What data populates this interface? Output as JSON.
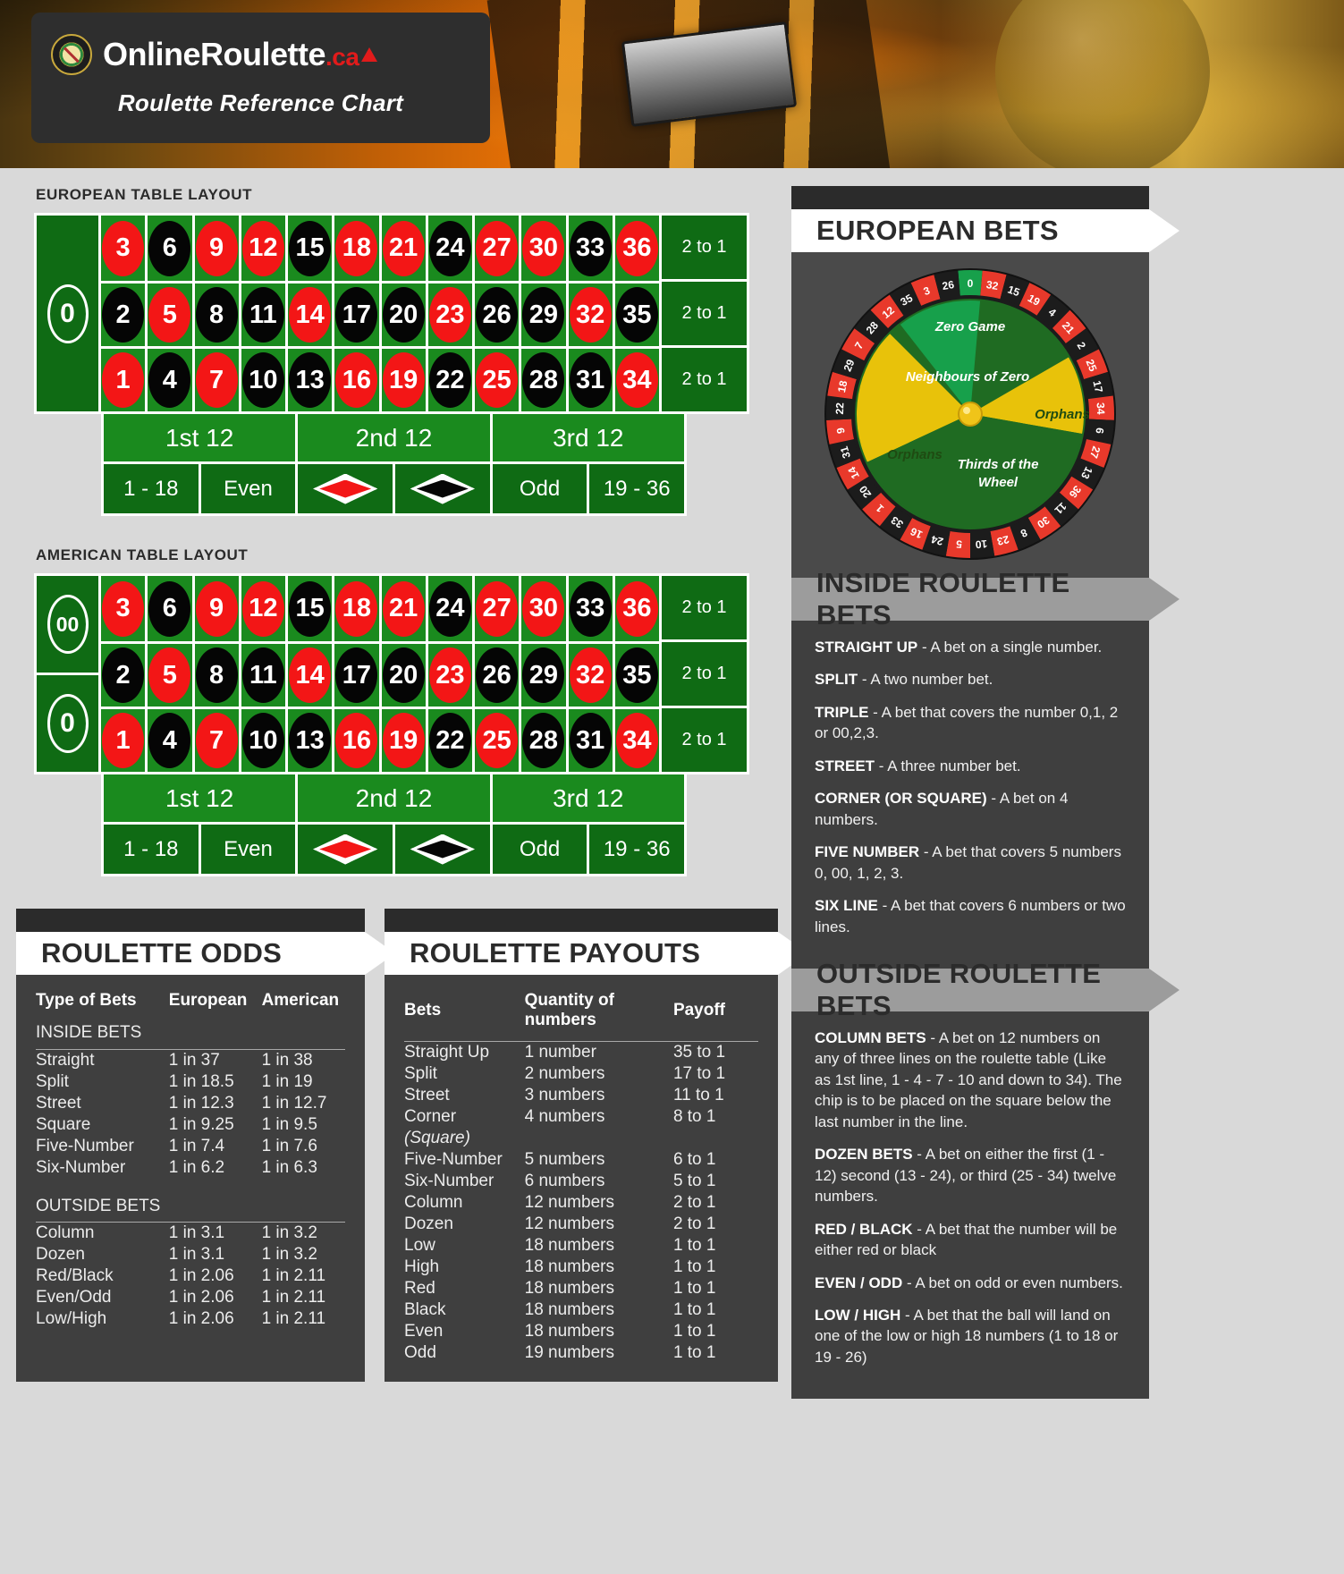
{
  "header": {
    "brand_online": "Online",
    "brand_roulette": "Roulette",
    "brand_tld": ".ca",
    "subtitle": "Roulette Reference Chart",
    "logo_icon": "roulette-wheel-chip-icon",
    "maple_icon": "maple-leaf-icon"
  },
  "european_table": {
    "label": "EUROPEAN TABLE LAYOUT",
    "zero": "0",
    "rows": [
      [
        {
          "n": "3",
          "c": "red"
        },
        {
          "n": "6",
          "c": "black"
        },
        {
          "n": "9",
          "c": "red"
        },
        {
          "n": "12",
          "c": "red"
        },
        {
          "n": "15",
          "c": "black"
        },
        {
          "n": "18",
          "c": "red"
        },
        {
          "n": "21",
          "c": "red"
        },
        {
          "n": "24",
          "c": "black"
        },
        {
          "n": "27",
          "c": "red"
        },
        {
          "n": "30",
          "c": "red"
        },
        {
          "n": "33",
          "c": "black"
        },
        {
          "n": "36",
          "c": "red"
        }
      ],
      [
        {
          "n": "2",
          "c": "black"
        },
        {
          "n": "5",
          "c": "red"
        },
        {
          "n": "8",
          "c": "black"
        },
        {
          "n": "11",
          "c": "black"
        },
        {
          "n": "14",
          "c": "red"
        },
        {
          "n": "17",
          "c": "black"
        },
        {
          "n": "20",
          "c": "black"
        },
        {
          "n": "23",
          "c": "red"
        },
        {
          "n": "26",
          "c": "black"
        },
        {
          "n": "29",
          "c": "black"
        },
        {
          "n": "32",
          "c": "red"
        },
        {
          "n": "35",
          "c": "black"
        }
      ],
      [
        {
          "n": "1",
          "c": "red"
        },
        {
          "n": "4",
          "c": "black"
        },
        {
          "n": "7",
          "c": "red"
        },
        {
          "n": "10",
          "c": "black"
        },
        {
          "n": "13",
          "c": "black"
        },
        {
          "n": "16",
          "c": "red"
        },
        {
          "n": "19",
          "c": "red"
        },
        {
          "n": "22",
          "c": "black"
        },
        {
          "n": "25",
          "c": "red"
        },
        {
          "n": "28",
          "c": "black"
        },
        {
          "n": "31",
          "c": "black"
        },
        {
          "n": "34",
          "c": "red"
        }
      ]
    ],
    "column_bets": [
      "2 to 1",
      "2 to 1",
      "2 to 1"
    ],
    "dozens": [
      "1st 12",
      "2nd 12",
      "3rd 12"
    ],
    "outside": [
      "1 - 18",
      "Even",
      "red-diamond",
      "black-diamond",
      "Odd",
      "19 - 36"
    ]
  },
  "american_table": {
    "label": "AMERICAN TABLE LAYOUT",
    "zero_double": "00",
    "zero_single": "0",
    "rows": [
      [
        {
          "n": "3",
          "c": "red"
        },
        {
          "n": "6",
          "c": "black"
        },
        {
          "n": "9",
          "c": "red"
        },
        {
          "n": "12",
          "c": "red"
        },
        {
          "n": "15",
          "c": "black"
        },
        {
          "n": "18",
          "c": "red"
        },
        {
          "n": "21",
          "c": "red"
        },
        {
          "n": "24",
          "c": "black"
        },
        {
          "n": "27",
          "c": "red"
        },
        {
          "n": "30",
          "c": "red"
        },
        {
          "n": "33",
          "c": "black"
        },
        {
          "n": "36",
          "c": "red"
        }
      ],
      [
        {
          "n": "2",
          "c": "black"
        },
        {
          "n": "5",
          "c": "red"
        },
        {
          "n": "8",
          "c": "black"
        },
        {
          "n": "11",
          "c": "black"
        },
        {
          "n": "14",
          "c": "red"
        },
        {
          "n": "17",
          "c": "black"
        },
        {
          "n": "20",
          "c": "black"
        },
        {
          "n": "23",
          "c": "red"
        },
        {
          "n": "26",
          "c": "black"
        },
        {
          "n": "29",
          "c": "black"
        },
        {
          "n": "32",
          "c": "red"
        },
        {
          "n": "35",
          "c": "black"
        }
      ],
      [
        {
          "n": "1",
          "c": "red"
        },
        {
          "n": "4",
          "c": "black"
        },
        {
          "n": "7",
          "c": "red"
        },
        {
          "n": "10",
          "c": "black"
        },
        {
          "n": "13",
          "c": "black"
        },
        {
          "n": "16",
          "c": "red"
        },
        {
          "n": "19",
          "c": "red"
        },
        {
          "n": "22",
          "c": "black"
        },
        {
          "n": "25",
          "c": "red"
        },
        {
          "n": "28",
          "c": "black"
        },
        {
          "n": "31",
          "c": "black"
        },
        {
          "n": "34",
          "c": "red"
        }
      ]
    ],
    "column_bets": [
      "2 to 1",
      "2 to 1",
      "2 to 1"
    ],
    "dozens": [
      "1st 12",
      "2nd 12",
      "3rd 12"
    ],
    "outside": [
      "1 - 18",
      "Even",
      "red-diamond",
      "black-diamond",
      "Odd",
      "19 - 36"
    ]
  },
  "european_bets": {
    "title": "EUROPEAN BETS",
    "wheel_order": [
      "0",
      "32",
      "15",
      "19",
      "4",
      "21",
      "2",
      "25",
      "17",
      "34",
      "6",
      "27",
      "13",
      "36",
      "11",
      "30",
      "8",
      "23",
      "10",
      "5",
      "24",
      "16",
      "33",
      "1",
      "20",
      "14",
      "31",
      "9",
      "22",
      "18",
      "29",
      "7",
      "28",
      "12",
      "35",
      "3",
      "26"
    ],
    "wheel_red": [
      "32",
      "19",
      "21",
      "25",
      "34",
      "27",
      "36",
      "30",
      "23",
      "5",
      "16",
      "1",
      "14",
      "9",
      "18",
      "7",
      "12",
      "3"
    ],
    "sector_labels": [
      "Zero Game",
      "Neighbours of Zero",
      "Orphans",
      "Orphans",
      "Thirds of the Wheel"
    ]
  },
  "inside_bets": {
    "title": "INSIDE ROULETTE BETS",
    "items": [
      {
        "term": "STRAIGHT UP",
        "desc": " - A bet on a single number."
      },
      {
        "term": "SPLIT",
        "desc": " - A two number bet."
      },
      {
        "term": "TRIPLE",
        "desc": " - A bet that covers the number 0,1, 2 or 00,2,3."
      },
      {
        "term": "STREET",
        "desc": " - A three number bet."
      },
      {
        "term": "CORNER (OR SQUARE)",
        "desc": " - A bet on 4 numbers."
      },
      {
        "term": "FIVE NUMBER",
        "desc": " - A bet that covers 5 numbers 0, 00, 1, 2, 3."
      },
      {
        "term": "SIX LINE",
        "desc": " - A bet that covers 6 numbers or two lines."
      }
    ]
  },
  "outside_bets": {
    "title": "OUTSIDE ROULETTE BETS",
    "items": [
      {
        "term": "COLUMN BETS",
        "desc": " - A bet on 12 numbers on any of three lines on the roulette table (Like as 1st line, 1 - 4 - 7 - 10 and down to 34). The chip is to be placed on the square below the last number in the line."
      },
      {
        "term": "DOZEN BETS",
        "desc": " - A bet on either the first (1 - 12) second (13 - 24), or third (25 - 34) twelve numbers."
      },
      {
        "term": "RED / BLACK",
        "desc": " - A bet that the number will be either red or black"
      },
      {
        "term": "EVEN / ODD",
        "desc": " - A bet on odd or even numbers."
      },
      {
        "term": "LOW / HIGH",
        "desc": " - A bet that the ball will land on one of the low or high 18 numbers (1 to 18 or 19 - 26)"
      }
    ]
  },
  "odds": {
    "title": "ROULETTE ODDS",
    "headers": [
      "Type of Bets",
      "European",
      "American"
    ],
    "group1": "INSIDE BETS",
    "rows1": [
      [
        "Straight",
        "1 in 37",
        "1 in 38"
      ],
      [
        "Split",
        "1 in 18.5",
        "1 in 19"
      ],
      [
        "Street",
        "1 in 12.3",
        "1 in 12.7"
      ],
      [
        "Square",
        "1 in 9.25",
        "1 in 9.5"
      ],
      [
        "Five-Number",
        "1 in 7.4",
        "1 in 7.6"
      ],
      [
        "Six-Number",
        "1 in 6.2",
        "1 in 6.3"
      ]
    ],
    "group2": "OUTSIDE BETS",
    "rows2": [
      [
        "Column",
        "1 in 3.1",
        "1 in 3.2"
      ],
      [
        "Dozen",
        "1 in 3.1",
        "1 in 3.2"
      ],
      [
        "Red/Black",
        "1 in 2.06",
        "1 in 2.11"
      ],
      [
        "Even/Odd",
        "1 in 2.06",
        "1 in 2.11"
      ],
      [
        "Low/High",
        "1 in 2.06",
        "1 in 2.11"
      ]
    ]
  },
  "payouts": {
    "title": "ROULETTE PAYOUTS",
    "headers": [
      "Bets",
      "Quantity of numbers",
      "Payoff"
    ],
    "rows": [
      [
        "Straight Up",
        "1 number",
        "35 to 1"
      ],
      [
        "Split",
        "2 numbers",
        "17 to 1"
      ],
      [
        "Street",
        "3 numbers",
        "11 to 1"
      ],
      [
        "Corner",
        "4 numbers",
        "8 to 1"
      ],
      [
        "(Square)",
        "",
        ""
      ],
      [
        "Five-Number",
        "5 numbers",
        "6 to 1"
      ],
      [
        "Six-Number",
        "6 numbers",
        "5 to 1"
      ],
      [
        "Column",
        "12 numbers",
        "2 to 1"
      ],
      [
        "Dozen",
        "12 numbers",
        "2 to 1"
      ],
      [
        "Low",
        "18 numbers",
        "1 to 1"
      ],
      [
        "High",
        "18 numbers",
        "1 to 1"
      ],
      [
        "Red",
        "18 numbers",
        "1 to 1"
      ],
      [
        "Black",
        "18 numbers",
        "1 to 1"
      ],
      [
        "Even",
        "18 numbers",
        "1 to 1"
      ],
      [
        "Odd",
        "19 numbers",
        "1 to 1"
      ]
    ]
  },
  "colors": {
    "red": "#f31616",
    "black": "#050505",
    "felt_green": "#1a8a1e",
    "dark_green": "#0f6b14",
    "panel": "#3f3f3f",
    "banner_white": "#ffffff",
    "banner_grey": "#9c9c9c"
  }
}
